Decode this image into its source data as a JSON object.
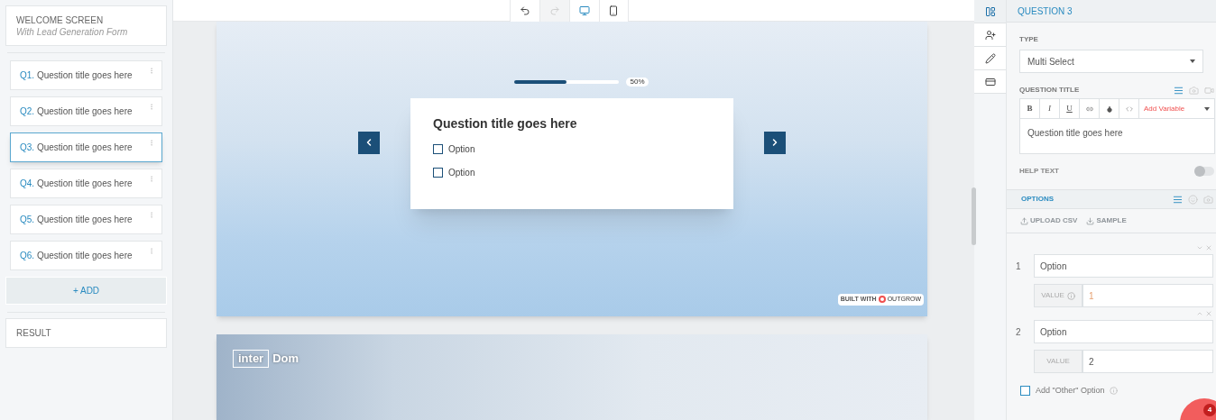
{
  "sidebar": {
    "welcome": {
      "title": "WELCOME SCREEN",
      "subtitle": "With Lead Generation Form"
    },
    "questions": [
      {
        "number": "Q1.",
        "title": "Question title goes here",
        "selected": false
      },
      {
        "number": "Q2.",
        "title": "Question title goes here",
        "selected": false
      },
      {
        "number": "Q3.",
        "title": "Question title goes here",
        "selected": true
      },
      {
        "number": "Q4.",
        "title": "Question title goes here",
        "selected": false
      },
      {
        "number": "Q5.",
        "title": "Question title goes here",
        "selected": false
      },
      {
        "number": "Q6.",
        "title": "Question title goes here",
        "selected": false
      }
    ],
    "add_button": "+ ADD",
    "result": "RESULT"
  },
  "toolbar": [
    {
      "kind": "undo",
      "disabled": false,
      "selected": false
    },
    {
      "kind": "redo",
      "disabled": true,
      "selected": false
    },
    {
      "kind": "desktop",
      "disabled": false,
      "selected": true
    },
    {
      "kind": "mobile",
      "disabled": false,
      "selected": false
    }
  ],
  "preview": {
    "progress": {
      "level": 0.5,
      "label": "50%"
    },
    "question": {
      "title": "Question title goes here",
      "options": [
        {
          "label": "Option",
          "checked": false
        },
        {
          "label": "Option",
          "checked": false
        }
      ]
    },
    "branding": {
      "prefix": "BUILT WITH",
      "name": "OUTGROW"
    },
    "next_logo": {
      "boxed": "inter",
      "rest": "Dom"
    }
  },
  "rail": [
    {
      "kind": "layout",
      "selected": true
    },
    {
      "kind": "user-add",
      "selected": false
    },
    {
      "kind": "edit",
      "selected": false
    },
    {
      "kind": "card",
      "selected": false
    }
  ],
  "panel": {
    "header": "QUESTION 3",
    "type_label": "TYPE",
    "type_value": "Multi Select",
    "title_label": "QUESTION TITLE",
    "format_buttons": [
      "B",
      "I",
      "U"
    ],
    "add_variable": "Add Variable",
    "title_text": "Question title goes here",
    "help_text": {
      "label": "HELP TEXT",
      "on": false
    },
    "options_header": "OPTIONS",
    "upload": "UPLOAD CSV",
    "sample": "SAMPLE",
    "options": [
      {
        "number": "1",
        "text": "Option",
        "value_label": "VALUE",
        "value": "1",
        "info": true,
        "move_up": false,
        "move_down": true
      },
      {
        "number": "2",
        "text": "Option",
        "value_label": "VALUE",
        "value": "2",
        "info": false,
        "move_up": true,
        "move_down": false
      }
    ],
    "add_other": {
      "label": "Add \"Other\" Option",
      "checked": false
    },
    "chat_badge": "4"
  }
}
